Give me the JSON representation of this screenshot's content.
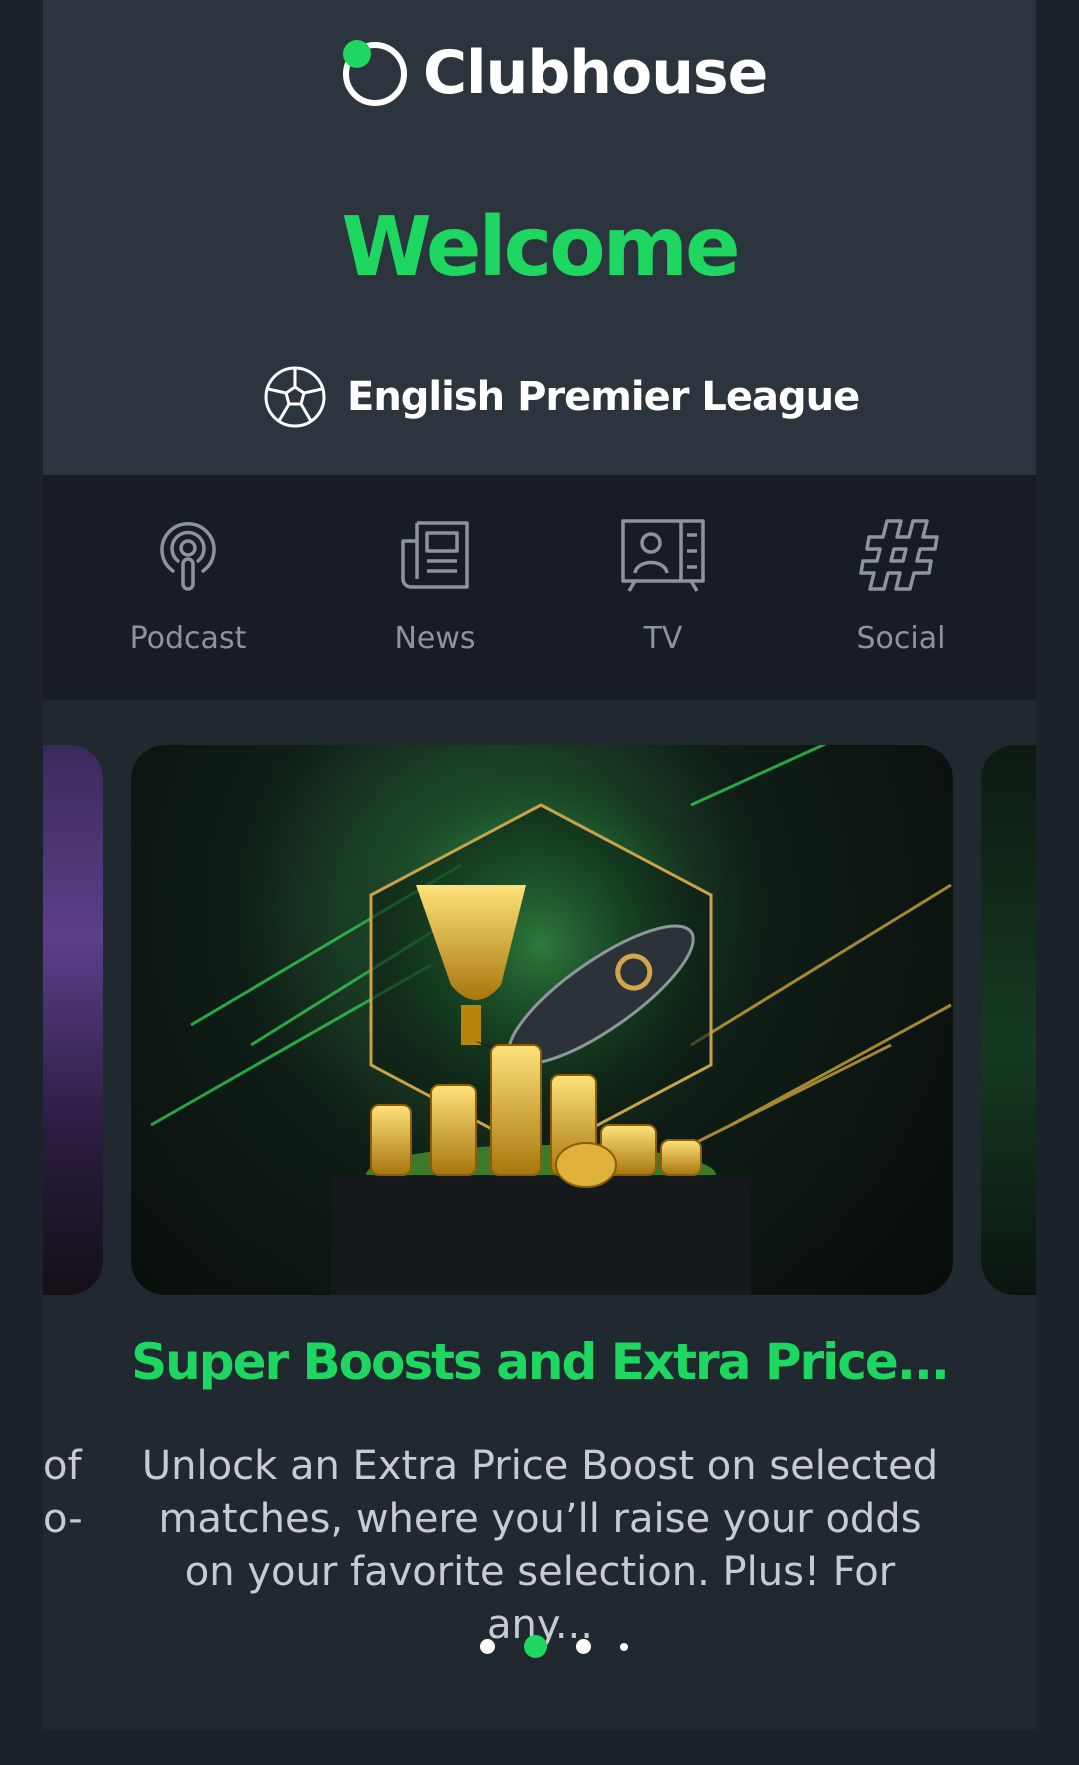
{
  "brand": {
    "name": "Clubhouse"
  },
  "welcome": "Welcome",
  "league": {
    "name": "English Premier League",
    "icon": "soccer-ball-icon"
  },
  "nav": [
    {
      "label": "Podcast",
      "icon": "podcast-icon"
    },
    {
      "label": "News",
      "icon": "newspaper-icon"
    },
    {
      "label": "TV",
      "icon": "tv-icon"
    },
    {
      "label": "Social",
      "icon": "hashtag-icon"
    }
  ],
  "promo": {
    "title": "Super Boosts and Extra Price...",
    "description": "Unlock an Extra Price Boost on selected matches, where you’ll raise your odds on your favorite selection. Plus! For any..."
  },
  "side_text": {
    "line1": "of",
    "line2": "o-"
  },
  "pagination": {
    "count": 4,
    "active_index": 1
  },
  "colors": {
    "accent": "#1ed760",
    "header_bg": "#2c353d",
    "nav_bg": "#171d22"
  }
}
